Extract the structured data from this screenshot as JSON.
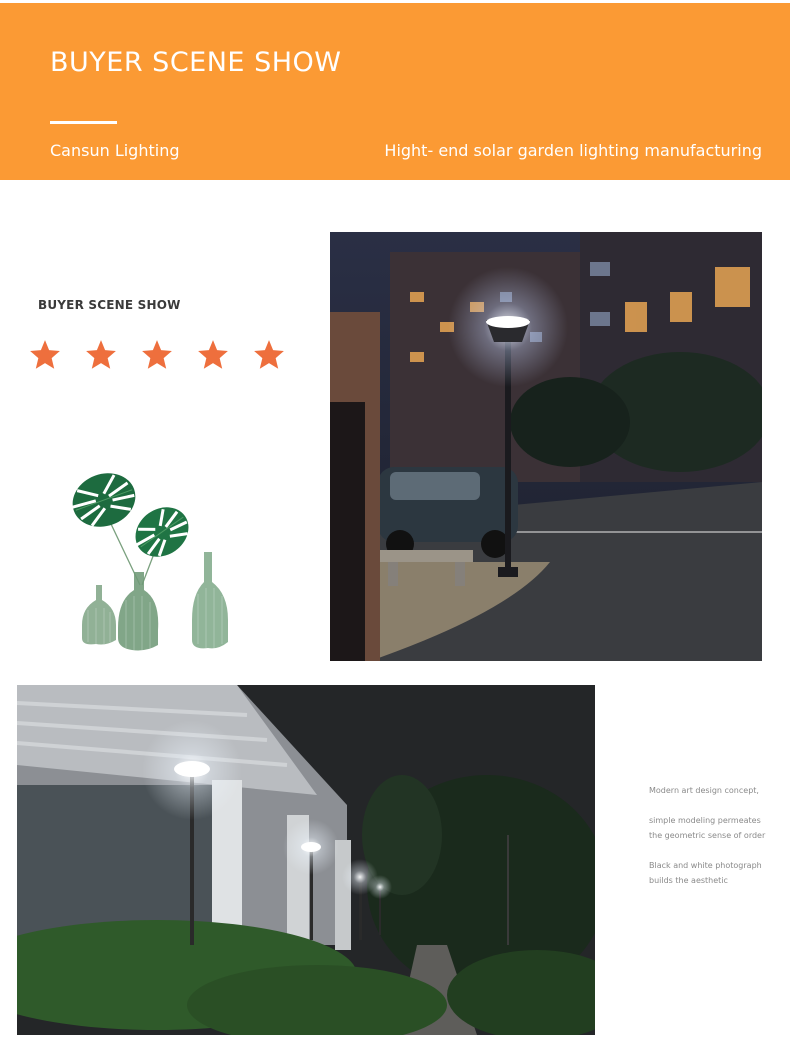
{
  "banner": {
    "title": "BUYER SCENE SHOW",
    "brand": "Cansun Lighting",
    "tagline": "Hight- end solar garden lighting manufacturing",
    "color": "#fb9a34"
  },
  "side": {
    "title": "BUYER SCENE SHOW",
    "rating": 5,
    "star_color": "#ee6f3d"
  },
  "description": [
    "Modern art design concept,",
    "simple modeling permeates the geometric sense of order",
    "Black and white photograph builds the aesthetic"
  ],
  "icons": {
    "star": "star-icon",
    "plant": "monstera-vase-illustration"
  }
}
